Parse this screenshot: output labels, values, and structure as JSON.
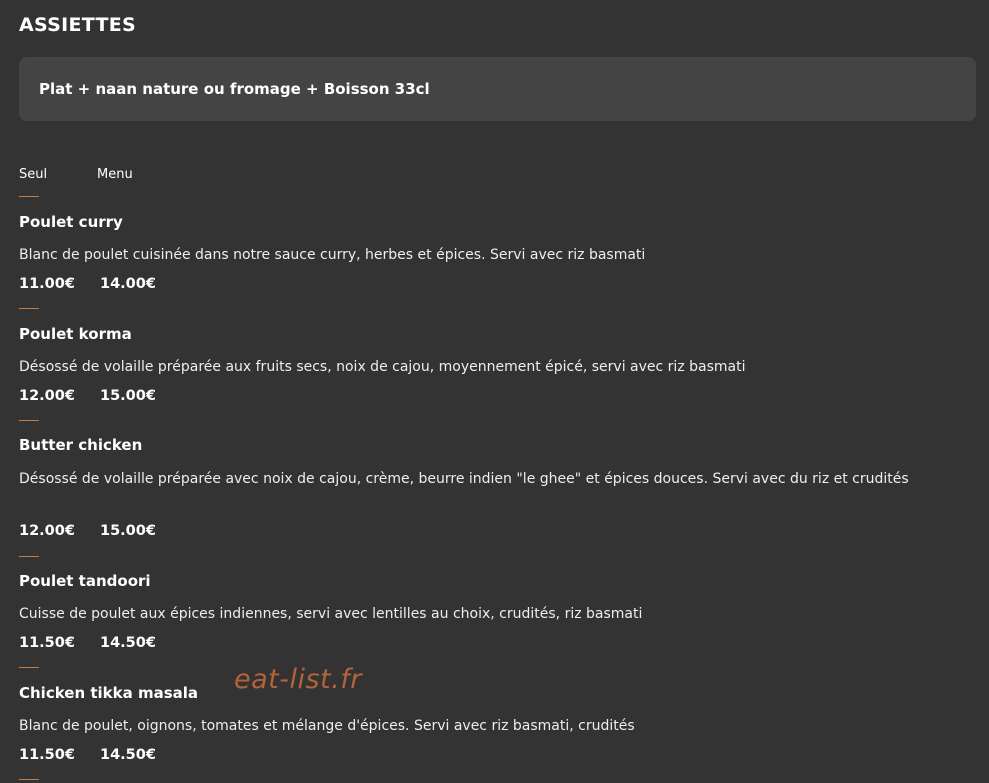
{
  "section": {
    "title": "ASSIETTES"
  },
  "info_box": {
    "text": "Plat + naan nature ou fromage + Boisson 33cl"
  },
  "columns": {
    "seul": "Seul",
    "menu": "Menu"
  },
  "items": [
    {
      "name": "Poulet curry",
      "description": "Blanc de poulet cuisinée dans notre sauce curry, herbes et épices. Servi avec riz basmati",
      "price_seul": "11.00€",
      "price_menu": "14.00€"
    },
    {
      "name": "Poulet korma",
      "description": "Désossé de volaille préparée aux fruits secs, noix de cajou, moyennement épicé, servi avec riz basmati",
      "price_seul": "12.00€",
      "price_menu": "15.00€"
    },
    {
      "name": "Butter chicken",
      "description": "Désossé de volaille préparée avec noix de cajou, crème, beurre indien \"le ghee\" et épices douces. Servi avec du riz et crudités",
      "price_seul": "12.00€",
      "price_menu": "15.00€"
    },
    {
      "name": "Poulet tandoori",
      "description": "Cuisse de poulet aux épices indiennes, servi avec lentilles au choix, crudités, riz basmati",
      "price_seul": "11.50€",
      "price_menu": "14.50€"
    },
    {
      "name": "Chicken tikka masala",
      "description": "Blanc de poulet, oignons, tomates et mélange d'épices. Servi avec riz basmati, crudités",
      "price_seul": "11.50€",
      "price_menu": "14.50€"
    }
  ],
  "watermark": {
    "text": "eat-list.fr"
  },
  "colors": {
    "background": "#333333",
    "box": "#444444",
    "accent": "#c87a45",
    "watermark": "#b3633a"
  }
}
